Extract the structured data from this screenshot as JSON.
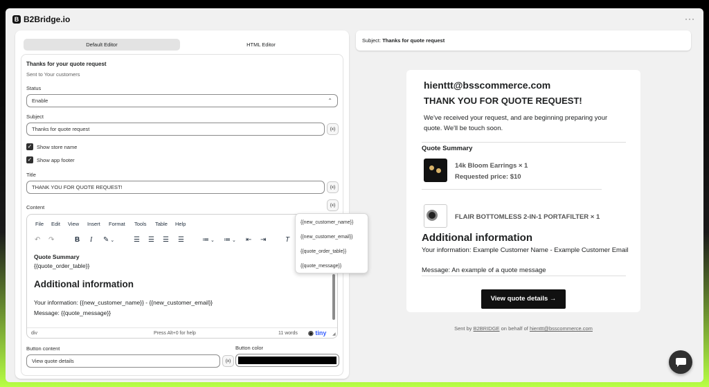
{
  "app": {
    "logo_letter": "B",
    "title": "B2Bridge.io",
    "more_label": "···"
  },
  "editor_tabs": [
    "Default Editor",
    "HTML Editor"
  ],
  "form": {
    "heading": "Thanks for your quote request",
    "subheading": "Sent to Your customers",
    "status_label": "Status",
    "status_value": "Enable",
    "subject_label": "Subject",
    "subject_value": "Thanks for quote request",
    "variable_button": "{x}",
    "show_store_name": "Show store name",
    "show_app_footer": "Show app footer",
    "title_label": "Title",
    "title_value": "THANK YOU FOR QUOTE REQUEST!",
    "content_label": "Content",
    "button_content_label": "Button content",
    "button_content_value": "View quote details",
    "button_color_label": "Button color",
    "button_color": "#000000"
  },
  "tinymce": {
    "menu": [
      "File",
      "Edit",
      "View",
      "Insert",
      "Format",
      "Tools",
      "Table",
      "Help"
    ],
    "content": {
      "quote_summary": "Quote Summary",
      "quote_table_var": "{{quote_order_table}}",
      "additional_heading": "Additional information",
      "your_info": "Your information: {{new_customer_name}} - {{new_customer_email}}",
      "message": "Message: {{quote_message}}"
    },
    "status": {
      "path": "div",
      "help": "Press Alt+0 for help",
      "words": "11 words",
      "brand": "tiny"
    }
  },
  "variables_dropdown": [
    "{{new_customer_name}}",
    "{{new_customer_email}}",
    "{{quote_order_table}}",
    "{{quote_message}}"
  ],
  "preview": {
    "subject_prefix": "Subject:",
    "subject_value": "Thanks for quote request",
    "store_email": "hienttt@bsscommerce.com",
    "title": "THANK YOU FOR QUOTE REQUEST!",
    "intro": "We've received your request, and are beginning preparing your quote. We'll be touch soon.",
    "summary_heading": "Quote Summary",
    "items": [
      {
        "name": "14k Bloom Earrings × 1",
        "price": "Requested price: $10"
      },
      {
        "name": "FLAIR BOTTOMLESS 2-IN-1 PORTAFILTER × 1",
        "price": ""
      }
    ],
    "additional_heading": "Additional information",
    "your_info": "Your information: Example Customer Name - Example Customer Email",
    "message": "Message: An example of a quote message",
    "cta": "View quote details →",
    "footer_sent_by": "Sent by",
    "footer_brand": "B2BRIDGE",
    "footer_on_behalf": "on behalf of",
    "footer_email": "hienttt@bsscommerce.com"
  }
}
